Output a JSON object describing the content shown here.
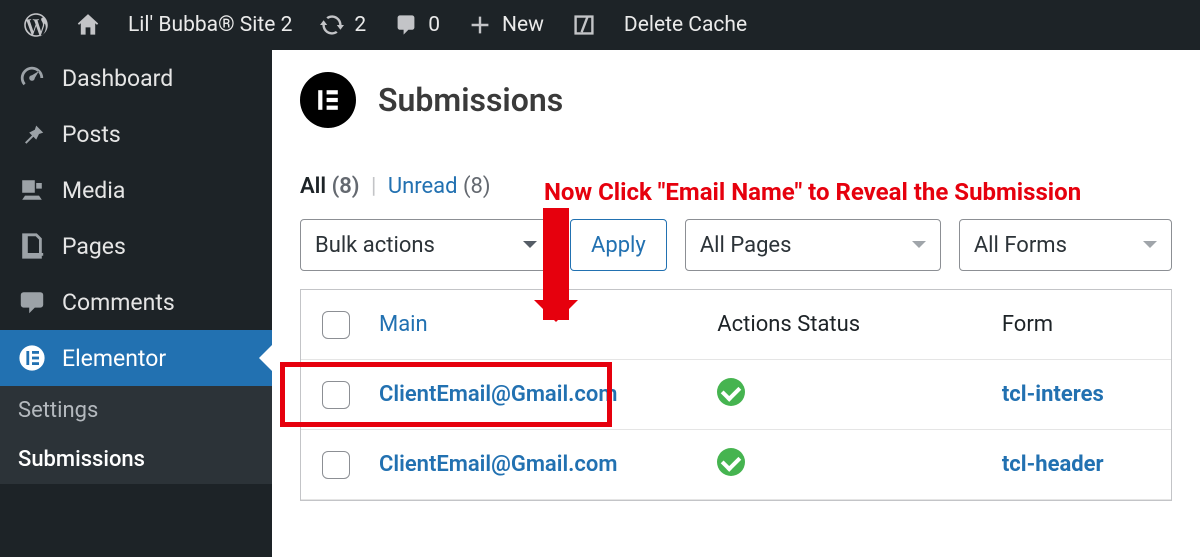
{
  "adminbar": {
    "site_name": "Lil' Bubba® Site 2",
    "updates_count": "2",
    "comments_count": "0",
    "new_label": "New",
    "delete_cache_label": "Delete Cache"
  },
  "sidebar": {
    "items": [
      {
        "label": "Dashboard"
      },
      {
        "label": "Posts"
      },
      {
        "label": "Media"
      },
      {
        "label": "Pages"
      },
      {
        "label": "Comments"
      },
      {
        "label": "Elementor"
      }
    ],
    "submenu": {
      "settings": "Settings",
      "submissions": "Submissions"
    }
  },
  "page": {
    "title": "Submissions",
    "elementor_glyph": "E"
  },
  "filters": {
    "all_label": "All",
    "all_count": "(8)",
    "unread_label": "Unread",
    "unread_count": "(8)"
  },
  "annotation": {
    "text": "Now Click \"Email Name\" to Reveal the Submission"
  },
  "actions": {
    "bulk_label": "Bulk actions",
    "apply_label": "Apply",
    "pages_label": "All Pages",
    "forms_label": "All Forms"
  },
  "table": {
    "headers": {
      "main": "Main",
      "status": "Actions Status",
      "form": "Form"
    },
    "rows": [
      {
        "main": "ClientEmail@Gmail.com",
        "form": "tcl-interes"
      },
      {
        "main": "ClientEmail@Gmail.com",
        "form": "tcl-header"
      }
    ]
  }
}
